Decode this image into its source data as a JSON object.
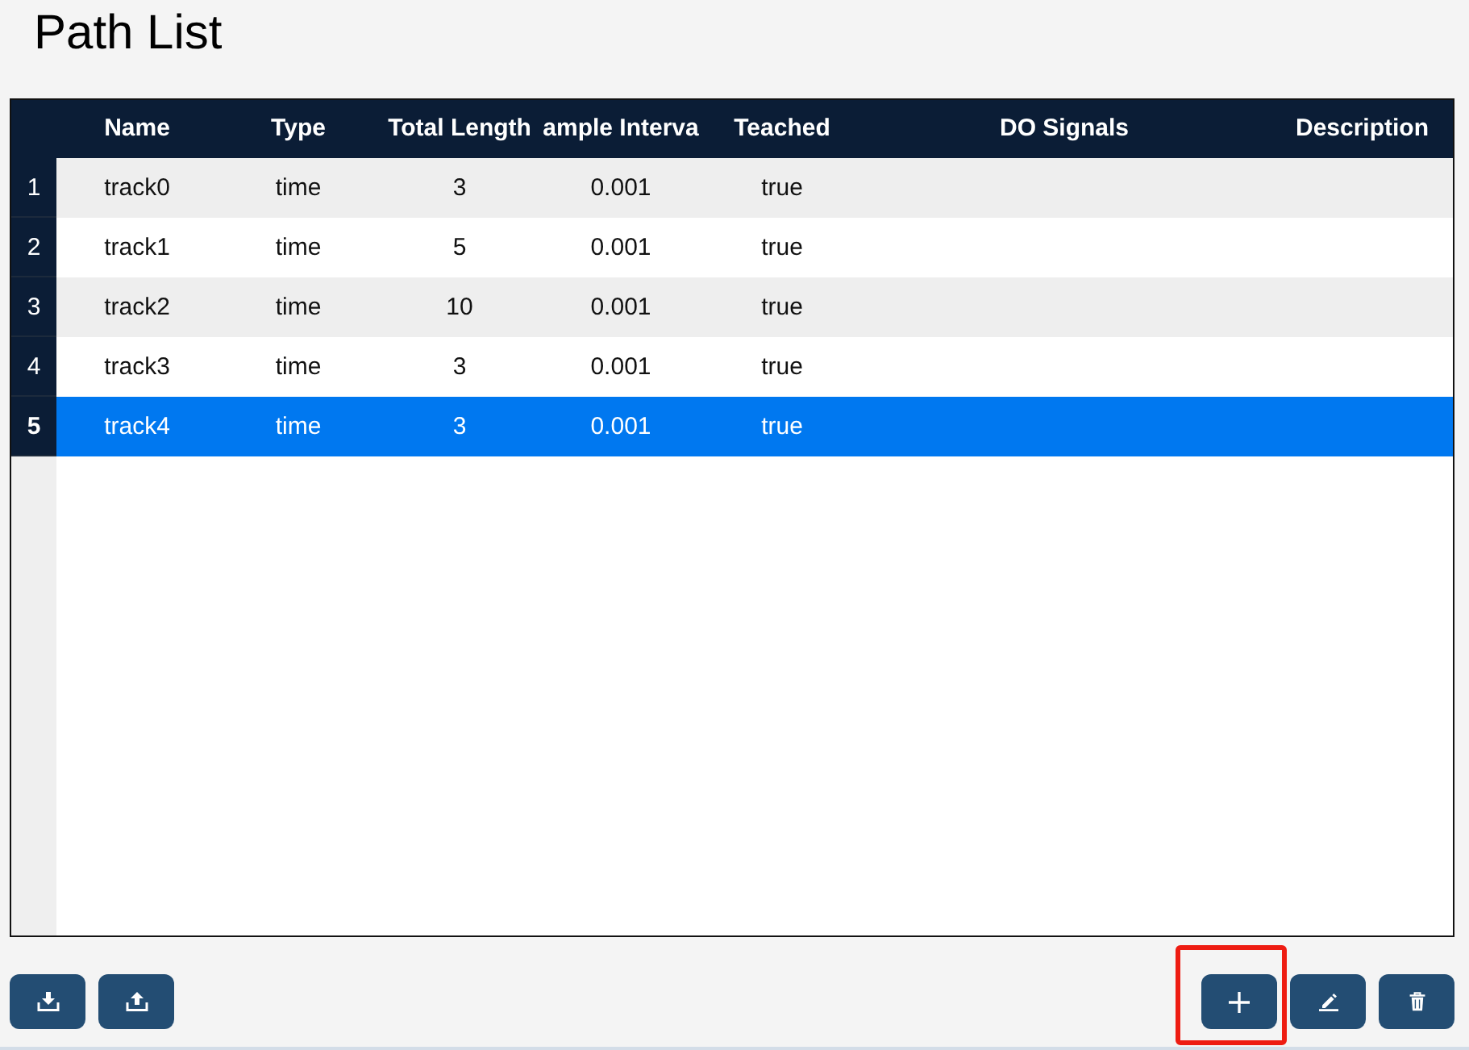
{
  "title": "Path List",
  "table": {
    "columns": [
      "Name",
      "Type",
      "Total Length",
      "ample Interva",
      "Teached",
      "DO Signals",
      "Description"
    ],
    "rows": [
      {
        "number": "1",
        "cells": [
          "track0",
          "time",
          "3",
          "0.001",
          "true"
        ],
        "selected": false
      },
      {
        "number": "2",
        "cells": [
          "track1",
          "time",
          "5",
          "0.001",
          "true"
        ],
        "selected": false
      },
      {
        "number": "3",
        "cells": [
          "track2",
          "time",
          "10",
          "0.001",
          "true"
        ],
        "selected": false
      },
      {
        "number": "4",
        "cells": [
          "track3",
          "time",
          "3",
          "0.001",
          "true"
        ],
        "selected": false
      },
      {
        "number": "5",
        "cells": [
          "track4",
          "time",
          "3",
          "0.001",
          "true"
        ],
        "selected": true
      }
    ]
  },
  "left_buttons": [
    {
      "kind": "download",
      "highlighted": false
    },
    {
      "kind": "upload",
      "highlighted": false
    }
  ],
  "right_buttons": [
    {
      "kind": "add",
      "highlighted": true
    },
    {
      "kind": "edit",
      "highlighted": false
    },
    {
      "kind": "delete",
      "highlighted": false
    }
  ]
}
